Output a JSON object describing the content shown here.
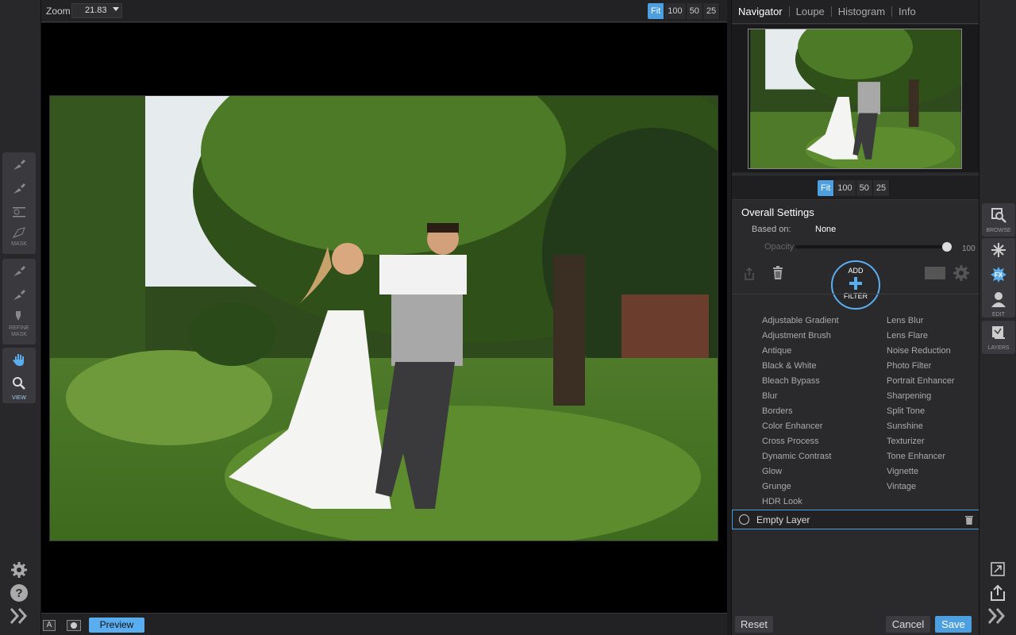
{
  "zoom": {
    "label": "Zoom",
    "value": "21.83",
    "presets": [
      "Fit",
      "100",
      "50",
      "25"
    ],
    "active": "Fit"
  },
  "left_tools": {
    "mask_label": "MASK",
    "refine_label": "REFINE\nMASK",
    "view_label": "VIEW"
  },
  "bottom": {
    "preview_label": "Preview",
    "a_label": "A"
  },
  "panel_tabs": [
    "Navigator",
    "Loupe",
    "Histogram",
    "Info"
  ],
  "nav_zoom": {
    "presets": [
      "Fit",
      "100",
      "50",
      "25"
    ],
    "active": "Fit"
  },
  "settings": {
    "title": "Overall Settings",
    "based_on_label": "Based on:",
    "based_on_value": "None",
    "opacity_label": "Opacity",
    "opacity_value": "100",
    "add_top": "ADD",
    "add_bottom": "FILTER"
  },
  "filters_left": [
    "Adjustable Gradient",
    "Adjustment Brush",
    "Antique",
    "Black & White",
    "Bleach Bypass",
    "Blur",
    "Borders",
    "Color Enhancer",
    "Cross Process",
    "Dynamic Contrast",
    "Glow",
    "Grunge",
    "HDR Look"
  ],
  "filters_right": [
    "Lens Blur",
    "Lens Flare",
    "Noise Reduction",
    "Photo Filter",
    "Portrait Enhancer",
    "Sharpening",
    "Split Tone",
    "Sunshine",
    "Texturizer",
    "Tone Enhancer",
    "Vignette",
    "Vintage"
  ],
  "layer": {
    "name": "Empty Layer"
  },
  "actions": {
    "reset": "Reset",
    "cancel": "Cancel",
    "save": "Save"
  },
  "right_tools": {
    "browse": "BROWSE",
    "edit": "EDIT",
    "layers": "LAYERS"
  },
  "colors": {
    "accent": "#4d9fe0"
  }
}
